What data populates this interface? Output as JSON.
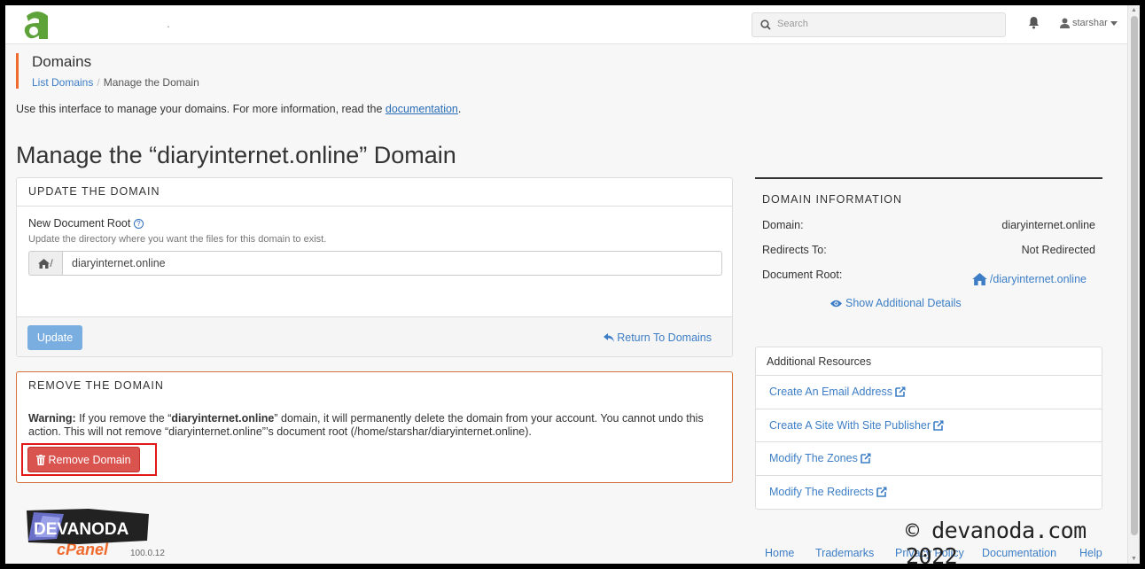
{
  "topbar": {
    "separator": ".",
    "search_placeholder": "Search",
    "username": "starshar"
  },
  "header": {
    "title": "Domains",
    "breadcrumb": [
      "List Domains",
      "Manage the Domain"
    ]
  },
  "intro": {
    "text": "Use this interface to manage your domains. For more information, read the ",
    "link": "documentation",
    "end": "."
  },
  "page_title": "Manage the “diaryinternet.online” Domain",
  "update_panel": {
    "heading": "UPDATE THE DOMAIN",
    "field_label": "New Document Root",
    "hint": "Update the directory where you want the files for this domain to exist.",
    "addon": "/",
    "value": "diaryinternet.online",
    "update_label": "Update",
    "return_label": "Return To Domains"
  },
  "remove_panel": {
    "heading": "REMOVE THE DOMAIN",
    "warning_label": "Warning:",
    "warning_a": " If you remove the “",
    "domain": "diaryinternet.online",
    "warning_b": "” domain, it will permanently delete the domain from your account. You cannot undo this action. This will not remove “diaryinternet.online”’s document root (/home/starshar/diaryinternet.online).",
    "button_label": "Remove Domain"
  },
  "domain_info": {
    "heading": "DOMAIN INFORMATION",
    "rows": [
      {
        "key": "Domain:",
        "value": "diaryinternet.online"
      },
      {
        "key": "Redirects To:",
        "value": "Not Redirected"
      },
      {
        "key": "Document Root:",
        "value": "/diaryinternet.online"
      }
    ],
    "show_more": "Show Additional Details"
  },
  "resources": {
    "heading": "Additional Resources",
    "items": [
      "Create An Email Address",
      "Create A Site With Site Publisher",
      "Modify The Zones",
      "Modify The Redirects"
    ]
  },
  "footer": {
    "brand": "cPanel",
    "version": "100.0.12",
    "links": [
      "Home",
      "Trademarks",
      "Privacy Policy",
      "Documentation",
      "Help"
    ],
    "watermark": "© devanoda.com 2022",
    "dev_logo_text": "DEVANODA"
  },
  "colors": {
    "accent": "#f06a2e",
    "link": "#3d7ec6",
    "danger": "#d9534f",
    "update_button": "#7aaee0",
    "highlight": "#e01818"
  }
}
